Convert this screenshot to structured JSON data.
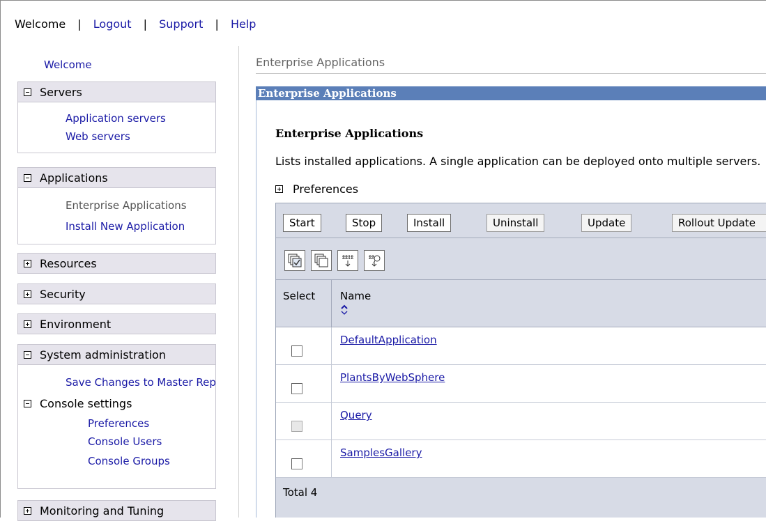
{
  "topnav": {
    "items": [
      {
        "label": "Welcome",
        "link": false
      },
      {
        "label": "Logout",
        "link": true
      },
      {
        "label": "Support",
        "link": true
      },
      {
        "label": "Help",
        "link": true
      }
    ],
    "separator": "|"
  },
  "sidebar": {
    "welcome": "Welcome",
    "sections": {
      "servers": {
        "label": "Servers",
        "expanded": true,
        "items": [
          "Application servers",
          "Web servers"
        ]
      },
      "applications": {
        "label": "Applications",
        "expanded": true,
        "items": [
          "Enterprise Applications",
          "Install New Application"
        ]
      },
      "resources": {
        "label": "Resources",
        "expanded": false
      },
      "security": {
        "label": "Security",
        "expanded": false
      },
      "environment": {
        "label": "Environment",
        "expanded": false
      },
      "sysadmin": {
        "label": "System administration",
        "expanded": true,
        "save": "Save Changes to Master Repository",
        "console_settings": {
          "label": "Console settings",
          "items": [
            "Preferences",
            "Console Users",
            "Console Groups"
          ]
        }
      },
      "monitoring": {
        "label": "Monitoring and Tuning",
        "expanded": false
      }
    }
  },
  "main": {
    "breadcrumb": "Enterprise Applications",
    "portlet_title": "Enterprise Applications",
    "heading": "Enterprise Applications",
    "description": "Lists installed applications. A single application can be deployed onto multiple servers.",
    "preferences": "Preferences",
    "buttons": [
      "Start",
      "Stop",
      "Install",
      "Uninstall",
      "Update",
      "Rollout Update"
    ],
    "table": {
      "col_select": "Select",
      "col_name": "Name",
      "rows": [
        "DefaultApplication",
        "PlantsByWebSphere",
        "Query",
        "SamplesGallery"
      ],
      "total": "Total 4"
    }
  }
}
